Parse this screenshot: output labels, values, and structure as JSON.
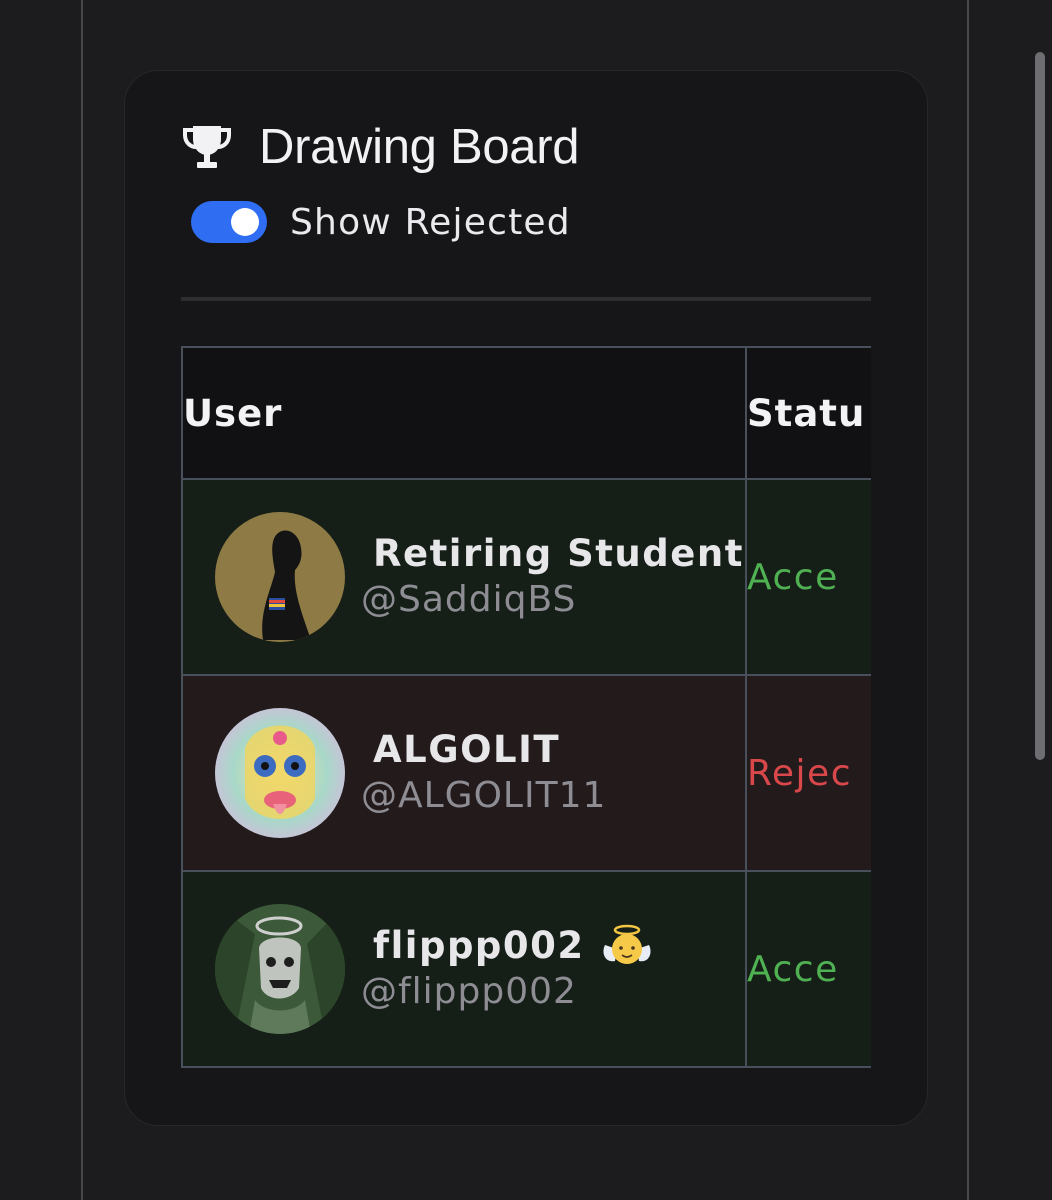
{
  "card": {
    "title": "Drawing Board",
    "trophy_icon": "trophy-icon",
    "toggle": {
      "label": "Show Rejected",
      "on": true,
      "color": "#2f6ef2"
    }
  },
  "table": {
    "headers": {
      "user": "User",
      "status": "Statu"
    },
    "rows": [
      {
        "name": "Retiring Student",
        "handle": "@SaddiqBS",
        "status": "Acce",
        "state": "accepted"
      },
      {
        "name": "ALGOLIT",
        "handle": "@ALGOLIT11",
        "status": "Rejec",
        "state": "rejected"
      },
      {
        "name": "flippp002",
        "handle": "@flippp002",
        "status": "Acce",
        "state": "accepted",
        "emoji": "angel-baby-icon"
      }
    ]
  },
  "colors": {
    "accepted_text": "#4fb152",
    "rejected_text": "#d8484b",
    "accepted_row": "#151e17",
    "rejected_row": "#231a1c"
  }
}
